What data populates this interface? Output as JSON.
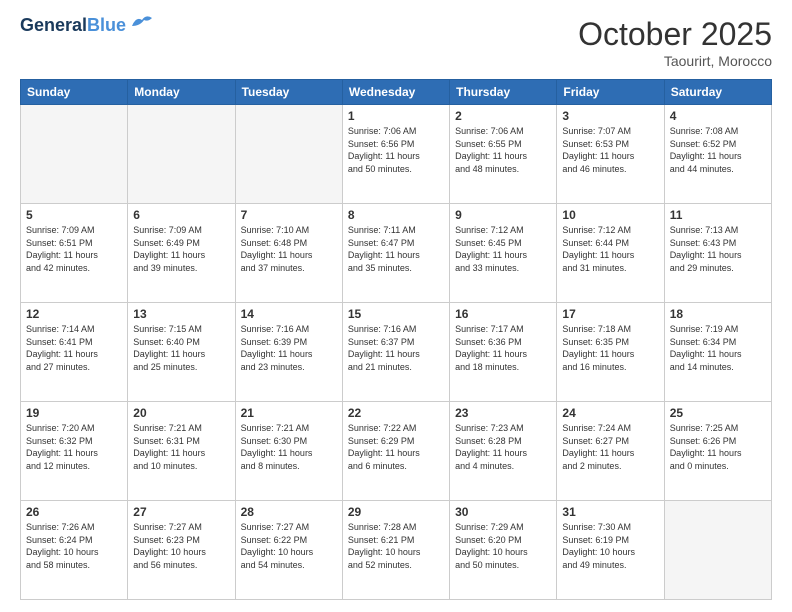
{
  "header": {
    "logo_line1": "General",
    "logo_line2": "Blue",
    "month": "October 2025",
    "location": "Taourirt, Morocco"
  },
  "days_of_week": [
    "Sunday",
    "Monday",
    "Tuesday",
    "Wednesday",
    "Thursday",
    "Friday",
    "Saturday"
  ],
  "weeks": [
    [
      {
        "num": "",
        "info": ""
      },
      {
        "num": "",
        "info": ""
      },
      {
        "num": "",
        "info": ""
      },
      {
        "num": "1",
        "info": "Sunrise: 7:06 AM\nSunset: 6:56 PM\nDaylight: 11 hours\nand 50 minutes."
      },
      {
        "num": "2",
        "info": "Sunrise: 7:06 AM\nSunset: 6:55 PM\nDaylight: 11 hours\nand 48 minutes."
      },
      {
        "num": "3",
        "info": "Sunrise: 7:07 AM\nSunset: 6:53 PM\nDaylight: 11 hours\nand 46 minutes."
      },
      {
        "num": "4",
        "info": "Sunrise: 7:08 AM\nSunset: 6:52 PM\nDaylight: 11 hours\nand 44 minutes."
      }
    ],
    [
      {
        "num": "5",
        "info": "Sunrise: 7:09 AM\nSunset: 6:51 PM\nDaylight: 11 hours\nand 42 minutes."
      },
      {
        "num": "6",
        "info": "Sunrise: 7:09 AM\nSunset: 6:49 PM\nDaylight: 11 hours\nand 39 minutes."
      },
      {
        "num": "7",
        "info": "Sunrise: 7:10 AM\nSunset: 6:48 PM\nDaylight: 11 hours\nand 37 minutes."
      },
      {
        "num": "8",
        "info": "Sunrise: 7:11 AM\nSunset: 6:47 PM\nDaylight: 11 hours\nand 35 minutes."
      },
      {
        "num": "9",
        "info": "Sunrise: 7:12 AM\nSunset: 6:45 PM\nDaylight: 11 hours\nand 33 minutes."
      },
      {
        "num": "10",
        "info": "Sunrise: 7:12 AM\nSunset: 6:44 PM\nDaylight: 11 hours\nand 31 minutes."
      },
      {
        "num": "11",
        "info": "Sunrise: 7:13 AM\nSunset: 6:43 PM\nDaylight: 11 hours\nand 29 minutes."
      }
    ],
    [
      {
        "num": "12",
        "info": "Sunrise: 7:14 AM\nSunset: 6:41 PM\nDaylight: 11 hours\nand 27 minutes."
      },
      {
        "num": "13",
        "info": "Sunrise: 7:15 AM\nSunset: 6:40 PM\nDaylight: 11 hours\nand 25 minutes."
      },
      {
        "num": "14",
        "info": "Sunrise: 7:16 AM\nSunset: 6:39 PM\nDaylight: 11 hours\nand 23 minutes."
      },
      {
        "num": "15",
        "info": "Sunrise: 7:16 AM\nSunset: 6:37 PM\nDaylight: 11 hours\nand 21 minutes."
      },
      {
        "num": "16",
        "info": "Sunrise: 7:17 AM\nSunset: 6:36 PM\nDaylight: 11 hours\nand 18 minutes."
      },
      {
        "num": "17",
        "info": "Sunrise: 7:18 AM\nSunset: 6:35 PM\nDaylight: 11 hours\nand 16 minutes."
      },
      {
        "num": "18",
        "info": "Sunrise: 7:19 AM\nSunset: 6:34 PM\nDaylight: 11 hours\nand 14 minutes."
      }
    ],
    [
      {
        "num": "19",
        "info": "Sunrise: 7:20 AM\nSunset: 6:32 PM\nDaylight: 11 hours\nand 12 minutes."
      },
      {
        "num": "20",
        "info": "Sunrise: 7:21 AM\nSunset: 6:31 PM\nDaylight: 11 hours\nand 10 minutes."
      },
      {
        "num": "21",
        "info": "Sunrise: 7:21 AM\nSunset: 6:30 PM\nDaylight: 11 hours\nand 8 minutes."
      },
      {
        "num": "22",
        "info": "Sunrise: 7:22 AM\nSunset: 6:29 PM\nDaylight: 11 hours\nand 6 minutes."
      },
      {
        "num": "23",
        "info": "Sunrise: 7:23 AM\nSunset: 6:28 PM\nDaylight: 11 hours\nand 4 minutes."
      },
      {
        "num": "24",
        "info": "Sunrise: 7:24 AM\nSunset: 6:27 PM\nDaylight: 11 hours\nand 2 minutes."
      },
      {
        "num": "25",
        "info": "Sunrise: 7:25 AM\nSunset: 6:26 PM\nDaylight: 11 hours\nand 0 minutes."
      }
    ],
    [
      {
        "num": "26",
        "info": "Sunrise: 7:26 AM\nSunset: 6:24 PM\nDaylight: 10 hours\nand 58 minutes."
      },
      {
        "num": "27",
        "info": "Sunrise: 7:27 AM\nSunset: 6:23 PM\nDaylight: 10 hours\nand 56 minutes."
      },
      {
        "num": "28",
        "info": "Sunrise: 7:27 AM\nSunset: 6:22 PM\nDaylight: 10 hours\nand 54 minutes."
      },
      {
        "num": "29",
        "info": "Sunrise: 7:28 AM\nSunset: 6:21 PM\nDaylight: 10 hours\nand 52 minutes."
      },
      {
        "num": "30",
        "info": "Sunrise: 7:29 AM\nSunset: 6:20 PM\nDaylight: 10 hours\nand 50 minutes."
      },
      {
        "num": "31",
        "info": "Sunrise: 7:30 AM\nSunset: 6:19 PM\nDaylight: 10 hours\nand 49 minutes."
      },
      {
        "num": "",
        "info": ""
      }
    ]
  ]
}
